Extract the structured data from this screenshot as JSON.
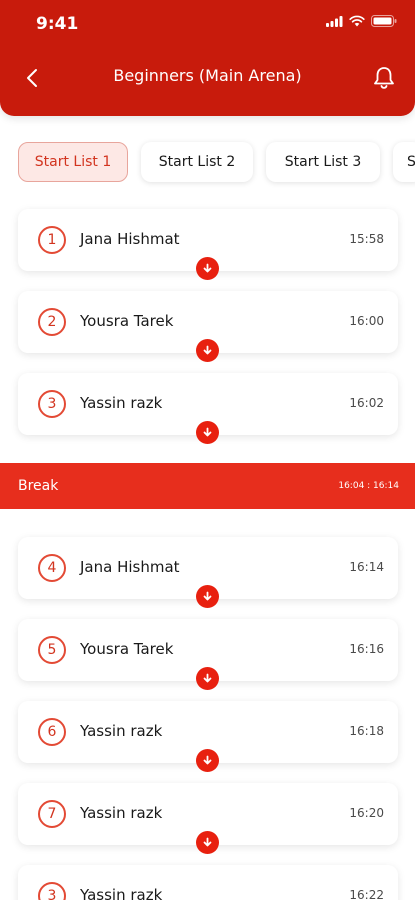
{
  "status_bar": {
    "time": "9:41"
  },
  "header": {
    "title": "Beginners (Main Arena)",
    "back_icon": "back-chevron-icon",
    "bell_icon": "bell-icon"
  },
  "tabs": [
    {
      "label": "Start List 1",
      "active": true
    },
    {
      "label": "Start List 2",
      "active": false
    },
    {
      "label": "Start List 3",
      "active": false
    },
    {
      "label": "S",
      "active": false
    }
  ],
  "entries": [
    {
      "number": "1",
      "name": "Jana Hishmat",
      "time": "15:58"
    },
    {
      "number": "2",
      "name": "Yousra Tarek",
      "time": "16:00"
    },
    {
      "number": "3",
      "name": "Yassin razk",
      "time": "16:02"
    }
  ],
  "break": {
    "label": "Break",
    "time": "16:04 : 16:14"
  },
  "entries_after_break": [
    {
      "number": "4",
      "name": "Jana Hishmat",
      "time": "16:14"
    },
    {
      "number": "5",
      "name": "Yousra Tarek",
      "time": "16:16"
    },
    {
      "number": "6",
      "name": "Yassin razk",
      "time": "16:18"
    },
    {
      "number": "7",
      "name": "Yassin razk",
      "time": "16:20"
    },
    {
      "number": "3",
      "name": "Yassin razk",
      "time": "16:22"
    }
  ],
  "colors": {
    "brand_red": "#c81b0c",
    "accent_red": "#e8200f",
    "break_red": "#e72e1d",
    "active_tab_bg": "#fde8e5"
  }
}
